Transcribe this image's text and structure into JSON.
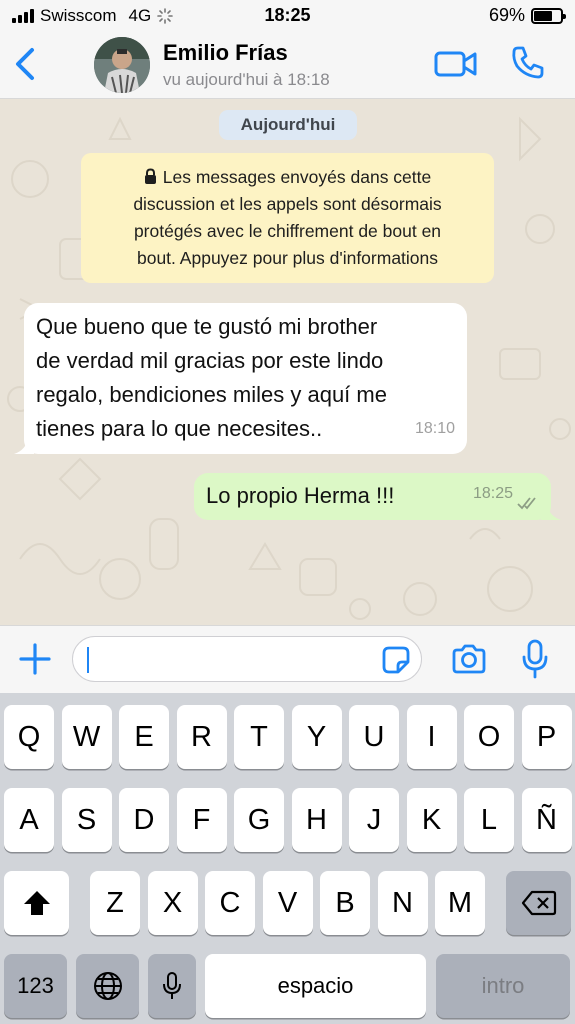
{
  "status_bar": {
    "carrier": "Swisscom",
    "network": "4G",
    "time": "18:25",
    "battery_text": "69%",
    "battery_level": 0.69
  },
  "header": {
    "contact_name": "Emilio Frías",
    "last_seen": "vu aujourd'hui à 18:18",
    "back_icon": "chevron-left-icon",
    "video_icon": "video-camera-icon",
    "call_icon": "phone-icon",
    "accent_color": "#1f86f5"
  },
  "chat": {
    "date_label": "Aujourd'hui",
    "encryption_lines": [
      "Les messages envoyés dans cette",
      "discussion et les appels sont désormais",
      "protégés avec le chiffrement de bout en",
      "bout. Appuyez pour plus d'informations"
    ],
    "messages": [
      {
        "direction": "incoming",
        "lines": [
          "Que bueno que te gustó mi brother",
          "de verdad mil gracias por este lindo",
          "regalo, bendiciones miles y aquí me",
          "tienes para lo que necesites.."
        ],
        "time": "18:10"
      },
      {
        "direction": "outgoing",
        "lines": [
          "Lo propio Herma !!!"
        ],
        "time": "18:25",
        "status_icon": "double-check-icon"
      }
    ]
  },
  "input_bar": {
    "value": "",
    "plus_icon": "plus-icon",
    "sticker_icon": "sticker-icon",
    "camera_icon": "camera-icon",
    "mic_icon": "microphone-icon"
  },
  "keyboard": {
    "row1": [
      "Q",
      "W",
      "E",
      "R",
      "T",
      "Y",
      "U",
      "I",
      "O",
      "P"
    ],
    "row2": [
      "A",
      "S",
      "D",
      "F",
      "G",
      "H",
      "J",
      "K",
      "L",
      "Ñ"
    ],
    "row3": [
      "Z",
      "X",
      "C",
      "V",
      "B",
      "N",
      "M"
    ],
    "numbers_key": "123",
    "space_key": "espacio",
    "return_key": "intro",
    "shift_icon": "shift-icon",
    "delete_icon": "backspace-icon",
    "globe_icon": "globe-icon",
    "dictation_icon": "microphone-icon"
  }
}
